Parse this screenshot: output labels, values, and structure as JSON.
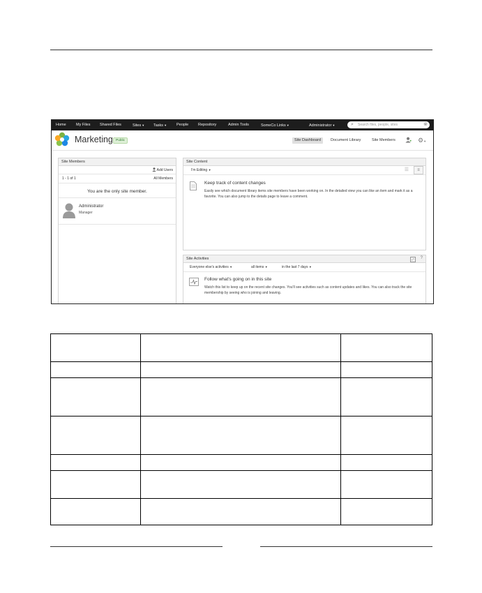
{
  "topnav": {
    "items": [
      {
        "label": "Home"
      },
      {
        "label": "My Files"
      },
      {
        "label": "Shared Files"
      },
      {
        "label": "Sites",
        "dropdown": true
      },
      {
        "label": "Tasks",
        "dropdown": true
      },
      {
        "label": "People"
      },
      {
        "label": "Repository"
      },
      {
        "label": "Admin Tools"
      },
      {
        "label": "SomeCo Links",
        "dropdown": true
      }
    ],
    "user_menu": "Administrator",
    "search_placeholder": "Search files, people, sites"
  },
  "site": {
    "title": "Marketing",
    "visibility": "Public",
    "tabs": [
      "Site Dashboard",
      "Document Library",
      "Site Members"
    ],
    "active_tab": "Site Dashboard"
  },
  "members": {
    "title": "Site Members",
    "add_users": "Add Users",
    "count": "1 - 1 of 1",
    "all_members": "All Members",
    "only_member_msg": "You are the only site member.",
    "member_name": "Administrator",
    "member_role": "Manager"
  },
  "content": {
    "title": "Site Content",
    "filter": "I'm Editing",
    "heading": "Keep track of content changes",
    "body": "Easily see which document library items site members have been working on. In the detailed view you can like an item and mark it as a favorite. You can also jump to the details page to leave a comment."
  },
  "activities": {
    "title": "Site Activities",
    "help": "?",
    "filter_who": "Everyone else's activities",
    "filter_what": "all items",
    "filter_when": "in the last 7 days",
    "heading": "Follow what's going on in this site",
    "body": "Watch this list to keep up on the recent site changes. You'll see activities such as content updates and likes. You can also track the site membership by seeing who is joining and leaving."
  },
  "colors": {
    "navbar": "#1d1d1d",
    "badge_green": "#2e7d2e",
    "border": "#d5d5d5"
  }
}
